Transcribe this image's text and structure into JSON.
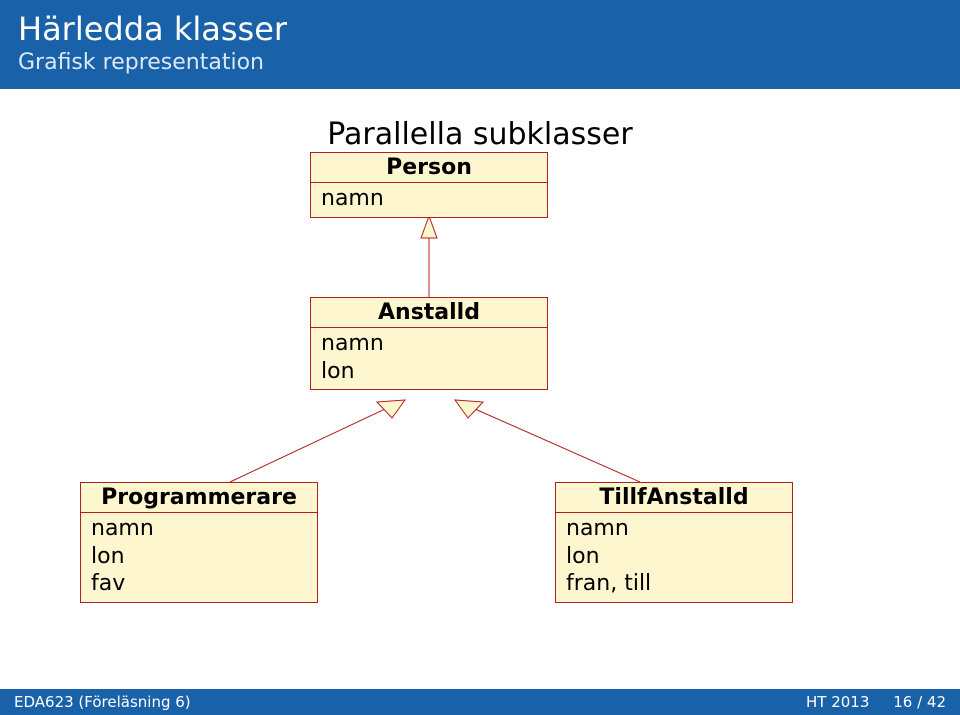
{
  "header": {
    "title": "Härledda klasser",
    "subtitle": "Grafisk representation"
  },
  "section_title": "Parallella subklasser",
  "classes": {
    "person": {
      "name": "Person",
      "members": "namn"
    },
    "anstalld": {
      "name": "Anstalld",
      "members": "namn\nlon"
    },
    "programmerare": {
      "name": "Programmerare",
      "members": "namn\nlon\nfav"
    },
    "tillfanstalld": {
      "name": "TillfAnstalld",
      "members": "namn\nlon\nfran, till"
    }
  },
  "footer": {
    "left": "EDA623 (Föreläsning 6)",
    "term": "HT 2013",
    "page": "16 / 42"
  },
  "chart_data": {
    "type": "table",
    "title": "Parallella subklasser",
    "nodes": [
      {
        "id": "Person",
        "attributes": [
          "namn"
        ]
      },
      {
        "id": "Anstalld",
        "attributes": [
          "namn",
          "lon"
        ]
      },
      {
        "id": "Programmerare",
        "attributes": [
          "namn",
          "lon",
          "fav"
        ]
      },
      {
        "id": "TillfAnstalld",
        "attributes": [
          "namn",
          "lon",
          "fran",
          "till"
        ]
      }
    ],
    "edges": [
      {
        "from": "Anstalld",
        "to": "Person",
        "relation": "inherits"
      },
      {
        "from": "Programmerare",
        "to": "Anstalld",
        "relation": "inherits"
      },
      {
        "from": "TillfAnstalld",
        "to": "Anstalld",
        "relation": "inherits"
      }
    ]
  }
}
